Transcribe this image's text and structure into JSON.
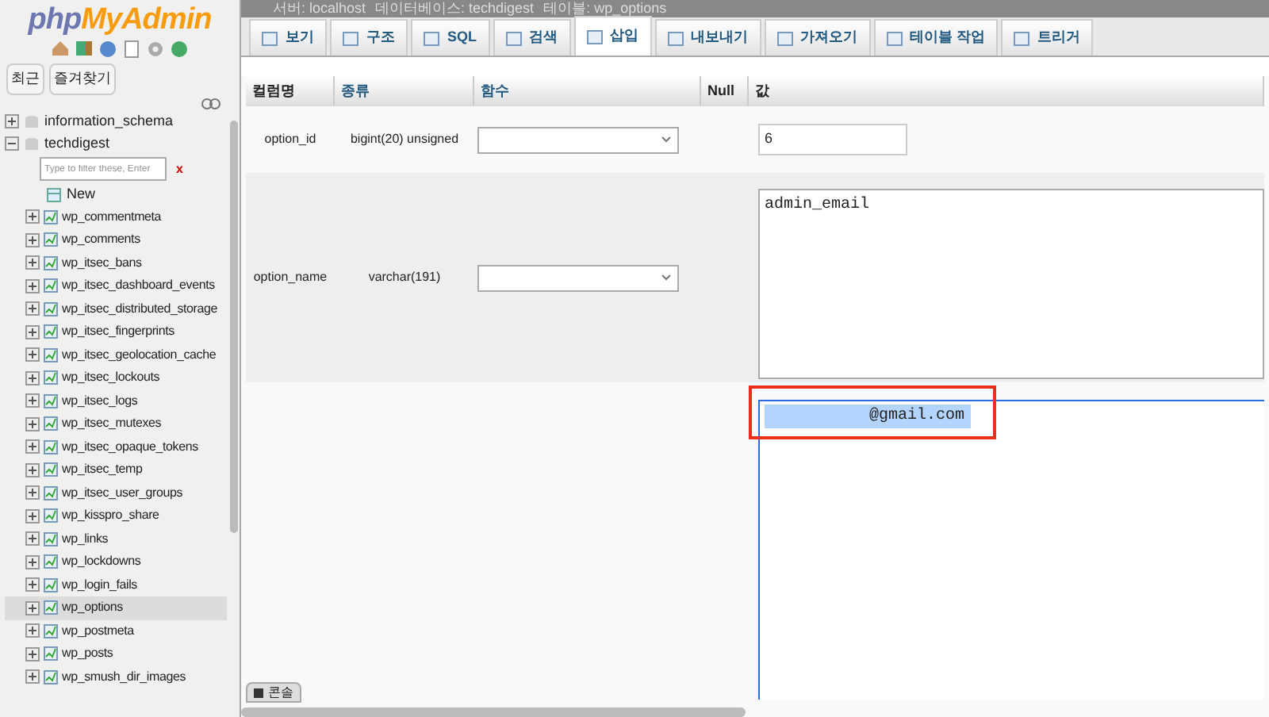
{
  "logo": {
    "php": "php",
    "myadmin": "MyAdmin"
  },
  "nav_buttons": [
    {
      "label": "최근"
    },
    {
      "label": "즐겨찾기"
    }
  ],
  "tree": [
    {
      "label": "information_schema",
      "expanded": false
    },
    {
      "label": "techdigest",
      "expanded": true,
      "filter": {
        "placeholder": "Type to filter these, Enter"
      },
      "clear": "x",
      "new_label": "New",
      "children": [
        {
          "label": "wp_commentmeta",
          "selected": false
        },
        {
          "label": "wp_comments",
          "selected": false
        },
        {
          "label": "wp_itsec_bans",
          "selected": false
        },
        {
          "label": "wp_itsec_dashboard_events",
          "selected": false
        },
        {
          "label": "wp_itsec_distributed_storage",
          "selected": false
        },
        {
          "label": "wp_itsec_fingerprints",
          "selected": false
        },
        {
          "label": "wp_itsec_geolocation_cache",
          "selected": false
        },
        {
          "label": "wp_itsec_lockouts",
          "selected": false
        },
        {
          "label": "wp_itsec_logs",
          "selected": false
        },
        {
          "label": "wp_itsec_mutexes",
          "selected": false
        },
        {
          "label": "wp_itsec_opaque_tokens",
          "selected": false
        },
        {
          "label": "wp_itsec_temp",
          "selected": false
        },
        {
          "label": "wp_itsec_user_groups",
          "selected": false
        },
        {
          "label": "wp_kisspro_share",
          "selected": false
        },
        {
          "label": "wp_links",
          "selected": false
        },
        {
          "label": "wp_lockdowns",
          "selected": false
        },
        {
          "label": "wp_login_fails",
          "selected": false
        },
        {
          "label": "wp_options",
          "selected": true
        },
        {
          "label": "wp_postmeta",
          "selected": false
        },
        {
          "label": "wp_posts",
          "selected": false
        },
        {
          "label": "wp_smush_dir_images",
          "selected": false
        }
      ]
    }
  ],
  "breadcrumb": [
    "서버: localhost",
    "데이터베이스: techdigest",
    "테이블: wp_options"
  ],
  "tabs": [
    {
      "label": "보기",
      "selected": false
    },
    {
      "label": "구조",
      "selected": false
    },
    {
      "label": "SQL",
      "selected": false
    },
    {
      "label": "검색",
      "selected": false
    },
    {
      "label": "삽입",
      "selected": true
    },
    {
      "label": "내보내기",
      "selected": false
    },
    {
      "label": "가져오기",
      "selected": false
    },
    {
      "label": "테이블 작업",
      "selected": false
    },
    {
      "label": "트리거",
      "selected": false
    }
  ],
  "table": {
    "columns": [
      "컬럼명",
      "종류",
      "함수",
      "Null",
      "값"
    ],
    "rows": [
      {
        "name": "option_id",
        "type": "bigint(20) unsigned",
        "kind": "input",
        "value": "6"
      },
      {
        "name": "option_name",
        "type": "varchar(191)",
        "kind": "textarea",
        "value": "admin_email"
      },
      {
        "kind": "textarea",
        "value": "@gmail.com",
        "value_selected": true,
        "highlighted": true
      }
    ]
  },
  "console": {
    "label": "콘솔"
  }
}
